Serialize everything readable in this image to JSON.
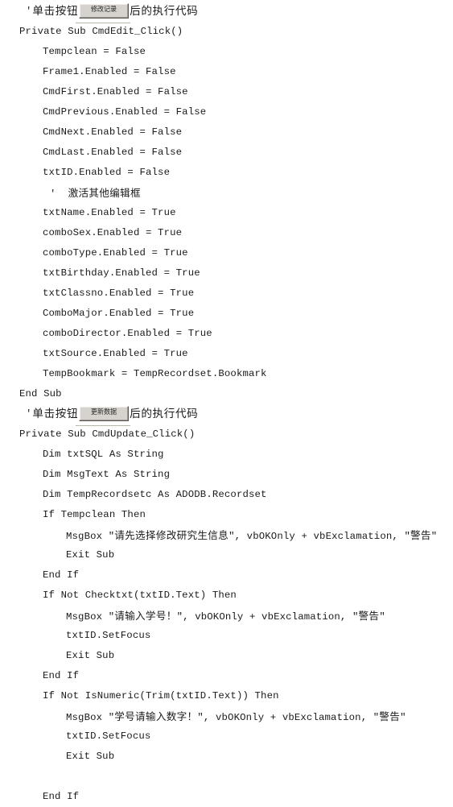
{
  "document": {
    "type": "visual-basic-source-listing",
    "language": "Visual Basic 6",
    "page_background": "#ffffff",
    "text_color": "#1a1a1a"
  },
  "buttons": {
    "edit": {
      "caption": "修改记录",
      "face_color": "#d6d3ce",
      "name": "CmdEdit"
    },
    "update": {
      "caption": "更新数据",
      "face_color": "#d6d3ce",
      "name": "CmdUpdate"
    }
  },
  "sections": [
    {
      "header": {
        "tick": "'",
        "pre": "单击按钮",
        "button": "修改记录",
        "post": "后的执行代码"
      },
      "procedure": "Private Sub CmdEdit_Click()"
    },
    {
      "header": {
        "tick": "'",
        "pre": "单击按钮",
        "button": "更新数据",
        "post": "后的执行代码"
      },
      "procedure": "Private Sub CmdUpdate_Click()"
    }
  ],
  "code_lines": [
    {
      "id": "l01",
      "text": "Private Sub CmdEdit_Click()",
      "indent": 0
    },
    {
      "id": "l02",
      "text": "Tempclean = False",
      "indent": 1
    },
    {
      "id": "l03",
      "text": "Frame1.Enabled = False",
      "indent": 1
    },
    {
      "id": "l04",
      "text": "CmdFirst.Enabled = False",
      "indent": 1
    },
    {
      "id": "l05",
      "text": "CmdPrevious.Enabled = False",
      "indent": 1
    },
    {
      "id": "l06",
      "text": "CmdNext.Enabled = False",
      "indent": 1
    },
    {
      "id": "l07",
      "text": "CmdLast.Enabled = False",
      "indent": 1
    },
    {
      "id": "l08",
      "text": "txtID.Enabled = False",
      "indent": 1
    },
    {
      "id": "l09",
      "text": "'  激活其他编辑框",
      "indent": 1,
      "comment": true
    },
    {
      "id": "l10",
      "text": "txtName.Enabled = True",
      "indent": 1
    },
    {
      "id": "l11",
      "text": "comboSex.Enabled = True",
      "indent": 1
    },
    {
      "id": "l12",
      "text": "comboType.Enabled = True",
      "indent": 1
    },
    {
      "id": "l13",
      "text": "txtBirthday.Enabled = True",
      "indent": 1
    },
    {
      "id": "l14",
      "text": "txtClassno.Enabled = True",
      "indent": 1
    },
    {
      "id": "l15",
      "text": "ComboMajor.Enabled = True",
      "indent": 1
    },
    {
      "id": "l16",
      "text": "comboDirector.Enabled = True",
      "indent": 1
    },
    {
      "id": "l17",
      "text": "txtSource.Enabled = True",
      "indent": 1
    },
    {
      "id": "l18",
      "text": "TempBookmark = TempRecordset.Bookmark",
      "indent": 1
    },
    {
      "id": "l19",
      "text": "End Sub",
      "indent": 0
    },
    {
      "id": "l20",
      "text": "Private Sub CmdUpdate_Click()",
      "indent": 0
    },
    {
      "id": "l21",
      "text": "Dim txtSQL As String",
      "indent": 1
    },
    {
      "id": "l22",
      "text": "Dim MsgText As String",
      "indent": 1
    },
    {
      "id": "l23",
      "text": "Dim TempRecordsetc As ADODB.Recordset",
      "indent": 1
    },
    {
      "id": "l24",
      "text": "If Tempclean Then",
      "indent": 1
    },
    {
      "id": "l25",
      "text": "MsgBox \"请先选择修改研究生信息\", vbOKOnly + vbExclamation, \"警告\"",
      "indent": 2
    },
    {
      "id": "l26",
      "text": "Exit Sub",
      "indent": 2
    },
    {
      "id": "l27",
      "text": "End If",
      "indent": 1
    },
    {
      "id": "l28",
      "text": "If Not Checktxt(txtID.Text) Then",
      "indent": 1
    },
    {
      "id": "l29",
      "text": "MsgBox \"请输入学号！\", vbOKOnly + vbExclamation, \"警告\"",
      "indent": 2
    },
    {
      "id": "l30",
      "text": "txtID.SetFocus",
      "indent": 2
    },
    {
      "id": "l31",
      "text": "Exit Sub",
      "indent": 2
    },
    {
      "id": "l32",
      "text": "End If",
      "indent": 1
    },
    {
      "id": "l33",
      "text": "If Not IsNumeric(Trim(txtID.Text)) Then",
      "indent": 1
    },
    {
      "id": "l34",
      "text": "MsgBox \"学号请输入数字！\", vbOKOnly + vbExclamation, \"警告\"",
      "indent": 2
    },
    {
      "id": "l35",
      "text": "txtID.SetFocus",
      "indent": 2
    },
    {
      "id": "l36",
      "text": "Exit Sub",
      "indent": 2
    },
    {
      "id": "l37",
      "text": "",
      "indent": 1
    },
    {
      "id": "l38",
      "text": "End If",
      "indent": 1
    }
  ],
  "code_parts": {
    "l25a": "MsgBox \"",
    "l25b": "请先选择修改研究生信息",
    "l25c": "\", vbOKOnly + vbExclamation, \"",
    "l25d": "警告",
    "l25e": "\"",
    "l29a": "MsgBox \"",
    "l29b": "请输入学号！",
    "l29c": "\", vbOKOnly + vbExclamation, \"",
    "l29d": "警告",
    "l29e": "\"",
    "l34a": "MsgBox \"",
    "l34b": "学号请输入数字！",
    "l34c": "\", vbOKOnly + vbExclamation, \"",
    "l34d": "警告",
    "l34e": "\"",
    "l09a": "'  ",
    "l09b": "激活其他编辑框"
  }
}
